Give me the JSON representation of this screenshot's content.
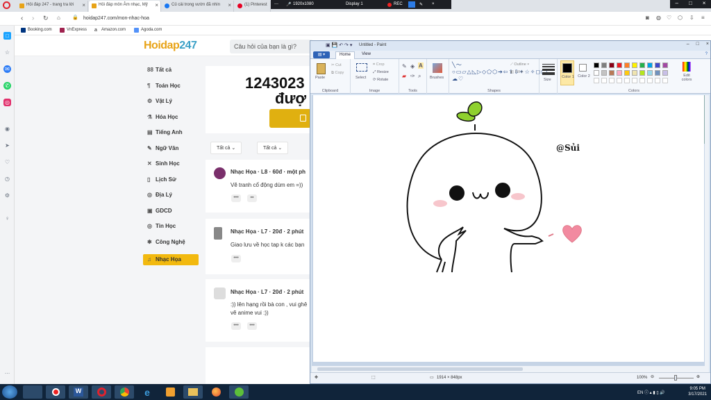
{
  "browser": {
    "tabs": [
      {
        "label": "Hỏi đáp 247 - trang tra lời",
        "fav": "#e8a317"
      },
      {
        "label": "Hỏi đáp môn Âm nhạc, Mỹ",
        "fav": "#e8a317"
      },
      {
        "label": "Củ cải trong vườn đã nhìn",
        "fav": "#1877f2"
      },
      {
        "label": "(1) Pinterest",
        "fav": "#e60023"
      }
    ],
    "url": "hoidap247.com/mon-nhac-hoa",
    "bookmarks": [
      {
        "label": "Booking.com",
        "color": "#003580"
      },
      {
        "label": "VnExpress",
        "color": "#9f224e"
      },
      {
        "label": "Amazon.com",
        "color": "#222"
      },
      {
        "label": "Agoda.com",
        "color": "#5392f9"
      }
    ],
    "recorder": {
      "resolution": "1920x1080",
      "display": "Display 1",
      "rec": "REC"
    }
  },
  "site": {
    "logo_a": "Hoidap",
    "logo_b": "247",
    "search_placeholder": "Câu hỏi của bạn là gì?",
    "subjects": [
      {
        "icon": "88",
        "label": "Tất cả"
      },
      {
        "icon": "¶",
        "label": "Toán Học"
      },
      {
        "icon": "⚙",
        "label": "Vật Lý"
      },
      {
        "icon": "⚗",
        "label": "Hóa Học"
      },
      {
        "icon": "▤",
        "label": "Tiếng Anh"
      },
      {
        "icon": "✎",
        "label": "Ngữ Văn"
      },
      {
        "icon": "✕",
        "label": "Sinh Học"
      },
      {
        "icon": "▯",
        "label": "Lịch Sử"
      },
      {
        "icon": "◎",
        "label": "Địa Lý"
      },
      {
        "icon": "▣",
        "label": "GDCD"
      },
      {
        "icon": "◎",
        "label": "Tin Học"
      },
      {
        "icon": "✱",
        "label": "Công Nghệ"
      },
      {
        "icon": "♫",
        "label": "Nhạc Họa"
      }
    ],
    "stat_line1": "1243023",
    "stat_line2": "đượ",
    "filters": [
      "Tất cả",
      "Tất cả"
    ],
    "posts": [
      {
        "meta": "Nhạc Họa · L8 · 60đ · một ph",
        "text": "Vẽ tranh cổ động dùm em =))",
        "avatar": "#7a2f6b"
      },
      {
        "meta": "Nhạc Họa · L7 · 20đ · 2 phút",
        "text": "Giao lưu về học tap k các bạn",
        "avatar": "#888"
      },
      {
        "meta": "Nhạc Họa · L7 · 20đ · 2 phút",
        "text": ":)) lên hạng rồi bà con , vui ghê\nvẽ anime vui :))",
        "avatar": "#ccc"
      }
    ]
  },
  "paint": {
    "title": "Untitled - Paint",
    "tabs": [
      "Home",
      "View"
    ],
    "groups": [
      "Clipboard",
      "Image",
      "Tools",
      "Shapes",
      "Colors"
    ],
    "labels": {
      "paste": "Paste",
      "cut": "Cut",
      "copy": "Copy",
      "select": "Select",
      "crop": "Crop",
      "resize": "Resize",
      "rotate": "Rotate",
      "brushes": "Brushes",
      "outline": "Outline",
      "fill": "Fill",
      "size": "Size",
      "color1": "Color 1",
      "color2": "Color 2",
      "edit_colors": "Edit colors"
    },
    "palette": [
      "#000000",
      "#7f7f7f",
      "#880015",
      "#ed1c24",
      "#ff7f27",
      "#fff200",
      "#22b14c",
      "#00a2e8",
      "#3f48cc",
      "#a349a4",
      "#ffffff",
      "#c3c3c3",
      "#b97a57",
      "#ffaec9",
      "#ffc90e",
      "#efe4b0",
      "#b5e61d",
      "#99d9ea",
      "#7092be",
      "#c8bfe7"
    ],
    "canvas_text": "@Sủi",
    "status_size": "1914 × 848px",
    "zoom": "100%"
  },
  "taskbar": {
    "time": "9:05 PM",
    "date": "3/17/2021",
    "lang": "EN"
  }
}
